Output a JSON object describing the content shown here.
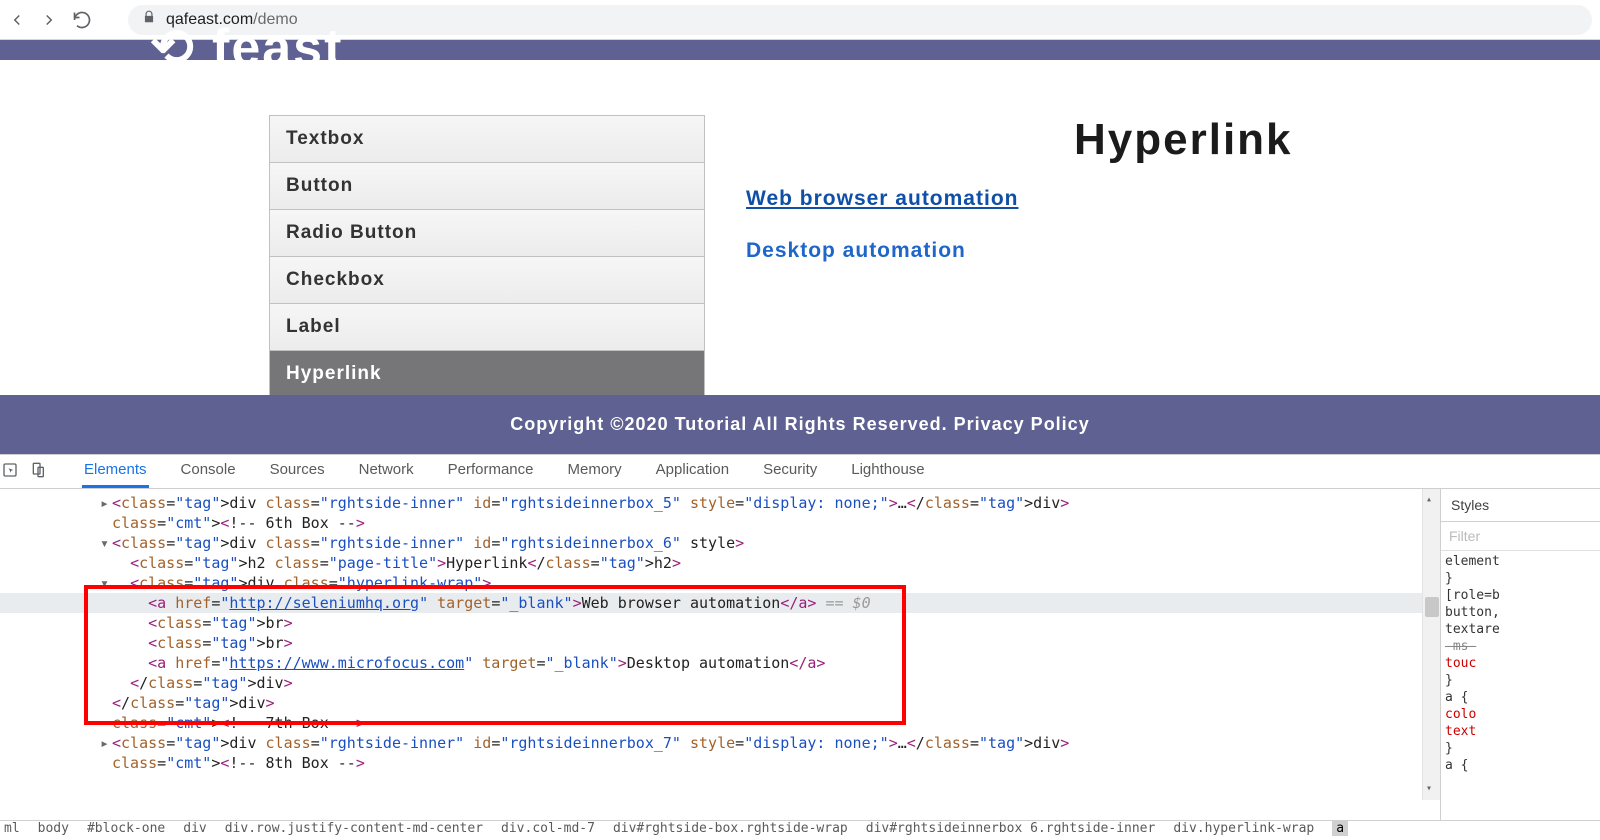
{
  "browser": {
    "url_domain": "qafeast.com",
    "url_path": "/demo"
  },
  "menu": {
    "items": [
      "Textbox",
      "Button",
      "Radio Button",
      "Checkbox",
      "Label",
      "Hyperlink"
    ],
    "active_index": 5
  },
  "page": {
    "title": "Hyperlink",
    "links": [
      {
        "text": "Web browser automation",
        "visited": true
      },
      {
        "text": "Desktop automation",
        "visited": false
      }
    ]
  },
  "footer": {
    "text": "Copyright ©2020 Tutorial All Rights Reserved. Privacy Policy"
  },
  "devtools": {
    "tabs": [
      "Elements",
      "Console",
      "Sources",
      "Network",
      "Performance",
      "Memory",
      "Application",
      "Security",
      "Lighthouse"
    ],
    "active_tab_index": 0,
    "styles": {
      "header": "Styles",
      "filter": "Filter",
      "rules": [
        "element",
        "}",
        "[role=b",
        "button,",
        "textare",
        "    -ms-",
        "    touc",
        "}",
        "a {",
        "    colo",
        "    text",
        "}",
        "a {"
      ]
    },
    "dom": {
      "line1_pre": "<div class=\"rghtside-inner\" id=\"rghtsideinnerbox_5\" style=\"display: none;\">…</div>",
      "line2": "<!-- 6th Box -->",
      "line3": "<div class=\"rghtside-inner\" id=\"rghtsideinnerbox_6\" style>",
      "line4": "<h2 class=\"page-title\">Hyperlink</h2>",
      "line5": "<div class=\"hyperlink-wrap\">",
      "link1_prefix": "<a href=\"",
      "link1_url": "http://seleniumhq.org",
      "link1_mid": "\" target=\"_blank\">",
      "link1_text": "Web browser automation",
      "link1_close": "</a>",
      "selected_hint": " == $0",
      "br": "<br>",
      "link2_url": "https://www.microfocus.com",
      "link2_text": "Desktop automation",
      "close_div": "</div>",
      "line_cmt7": "<!-- 7th Box -->",
      "line_box7": "<div class=\"rghtside-inner\" id=\"rghtsideinnerbox_7\" style=\"display: none;\">…</div>",
      "line_cmt8": "<!-- 8th Box -->"
    },
    "breadcrumb": [
      "ml",
      "body",
      "#block-one",
      "div",
      "div.row.justify-content-md-center",
      "div.col-md-7",
      "div#rghtside-box.rghtside-wrap",
      "div#rghtsideinnerbox 6.rghtside-inner",
      "div.hyperlink-wrap",
      "a"
    ]
  }
}
